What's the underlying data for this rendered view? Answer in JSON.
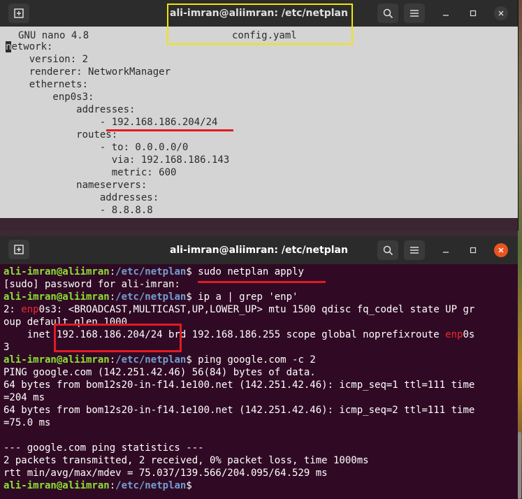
{
  "window1": {
    "title": "ali-imran@aliimran: /etc/netplan",
    "nano": {
      "app": "GNU nano 4.8",
      "filename": "config.yaml"
    },
    "lines": [
      "etwork:",
      "    version: 2",
      "    renderer: NetworkManager",
      "    ethernets:",
      "        enp0s3:",
      "            addresses:",
      "                - 192.168.186.204/24",
      "            routes:",
      "                - to: 0.0.0.0/0",
      "                  via: 192.168.186.143",
      "                  metric: 600",
      "            nameservers:",
      "                addresses:",
      "                - 8.8.8.8"
    ],
    "cursor_char": "n"
  },
  "window2": {
    "title": "ali-imran@aliimran: /etc/netplan",
    "prompt_user": "ali-imran@aliimran",
    "prompt_path": "/etc/netplan",
    "cmd1": " sudo netplan apply",
    "sudo_line": "[sudo] password for ali-imran: ",
    "cmd2": " ip a | grep 'enp'",
    "iface_pre": "2: ",
    "iface_name": "enp",
    "iface_post": "0s3: <BROADCAST,MULTICAST,UP,LOWER_UP> mtu 1500 qdisc fq_codel state UP gr",
    "iface_line2": "oup default qlen 1000",
    "inet_pre": "    inet 192.168.186.204/24 brd 192.168.186.255 scope global noprefixroute ",
    "inet_name": "enp",
    "inet_post": "0s",
    "inet_line2": "3",
    "cmd3": " ping google.com -c 2",
    "ping_lines": [
      "PING google.com (142.251.42.46) 56(84) bytes of data.",
      "64 bytes from bom12s20-in-f14.1e100.net (142.251.42.46): icmp_seq=1 ttl=111 time",
      "=204 ms",
      "64 bytes from bom12s20-in-f14.1e100.net (142.251.42.46): icmp_seq=2 ttl=111 time",
      "=75.0 ms",
      "",
      "--- google.com ping statistics ---",
      "2 packets transmitted, 2 received, 0% packet loss, time 1000ms",
      "rtt min/avg/max/mdev = 75.037/139.566/204.095/64.529 ms"
    ]
  },
  "colors": {
    "terminal_bg": "#300a24",
    "prompt_user": "#8ae234",
    "prompt_path": "#729fcf",
    "annotation_red": "#e01b24",
    "annotation_yellow": "#f2e600",
    "close_button": "#e95420"
  },
  "icons": {
    "new_tab": "new-tab-icon",
    "search": "search-icon",
    "menu": "hamburger-menu-icon",
    "minimize": "minimize-icon",
    "maximize": "maximize-icon",
    "close": "close-icon"
  }
}
